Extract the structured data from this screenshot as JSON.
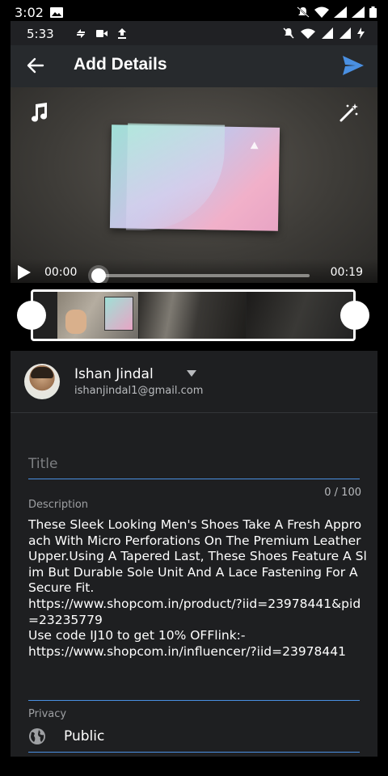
{
  "outer_status": {
    "time": "3:02"
  },
  "inner_status": {
    "time": "5:33"
  },
  "app_bar": {
    "title": "Add Details"
  },
  "video": {
    "current_time": "00:00",
    "total_time": "00:19",
    "progress": 0.0
  },
  "account": {
    "name": "Ishan Jindal",
    "email": "ishanjindal1@gmail.com"
  },
  "form": {
    "title_placeholder": "Title",
    "counter": "0 / 100",
    "description_label": "Description",
    "description": "These Sleek Looking Men's Shoes Take A Fresh Approach With Micro Perforations On The Premium Leather Upper.Using A Tapered Last, These Shoes Feature A Slim But Durable Sole Unit And A Lace Fastening For A Secure Fit.\nhttps://www.shopcom.in/product/?iid=23978441&pid=23235779\nUse code IJ10 to get 10% OFFlink:-\nhttps://www.shopcom.in/influencer/?iid=23978441",
    "privacy_label": "Privacy",
    "privacy_value": "Public"
  },
  "colors": {
    "accent": "#4a90e2",
    "send": "#4a90e2",
    "background": "#1e1f21"
  }
}
